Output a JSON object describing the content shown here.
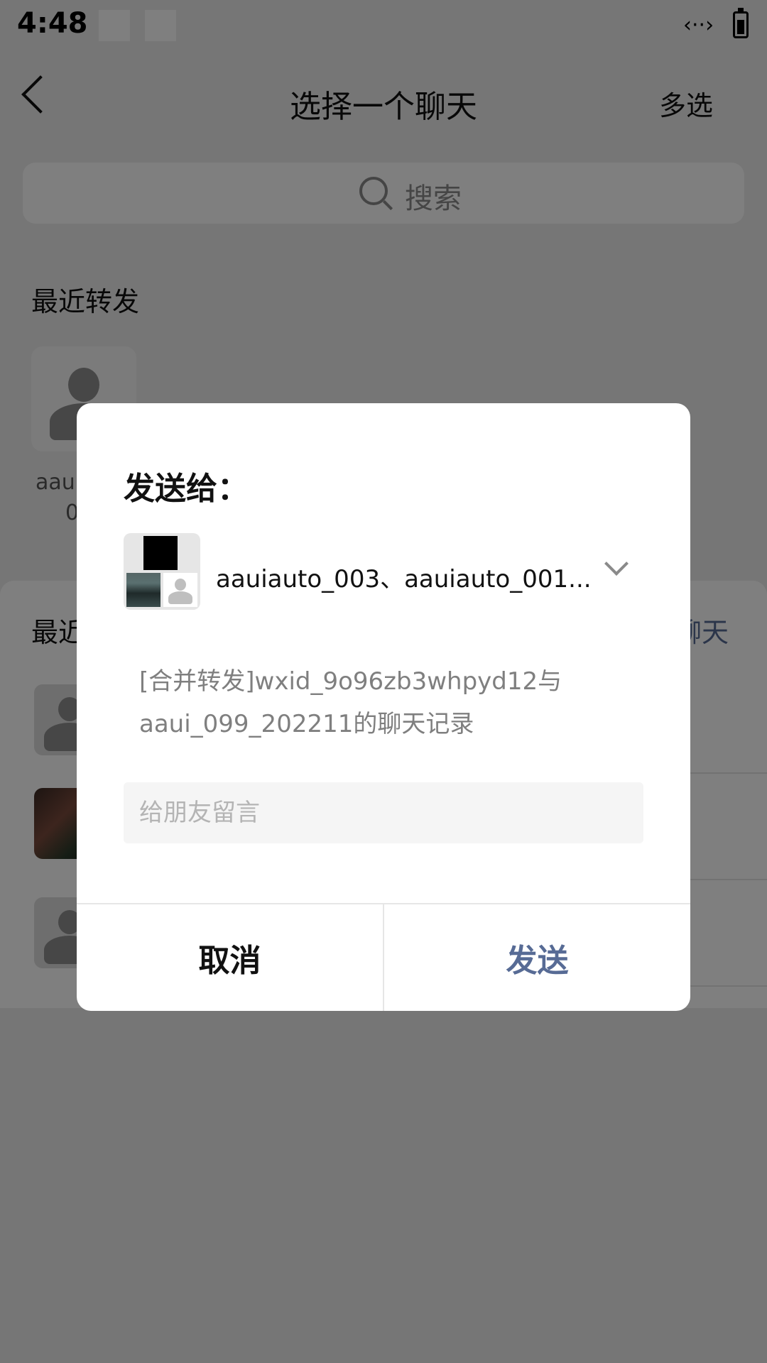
{
  "status_bar": {
    "time": "4:48",
    "network_icon": "‹··›"
  },
  "header": {
    "title": "选择一个聊天",
    "multi_select": "多选"
  },
  "search": {
    "placeholder": "搜索"
  },
  "recent_forward": {
    "label": "最近转发",
    "contact_name_line1": "aaui",
    "contact_name_line2": "0"
  },
  "chat_list": {
    "label": "最近",
    "right_label": "聊天"
  },
  "dialog": {
    "title": "发送给：",
    "recipients": "aauiauto_003、aauiauto_001...",
    "message_preview": "[合并转发]wxid_9o96zb3whpyd12与aaui_099_202211的聊天记录",
    "input_placeholder": "给朋友留言",
    "cancel": "取消",
    "send": "发送"
  },
  "colors": {
    "accent": "#576b95",
    "overlay": "rgba(0,0,0,0.5)"
  }
}
